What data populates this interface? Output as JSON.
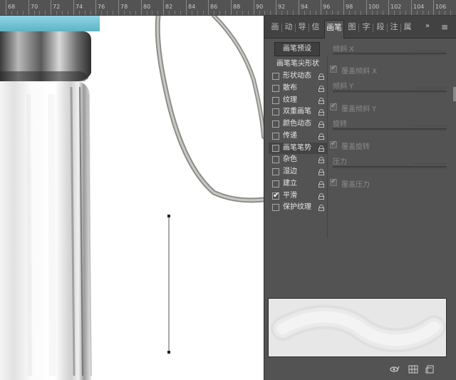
{
  "ruler": {
    "labels": [
      "68",
      "70",
      "72",
      "74",
      "76",
      "78",
      "80",
      "82",
      "84",
      "86",
      "88",
      "90",
      "92",
      "94",
      "96",
      "98",
      "100",
      "102",
      "104",
      "106"
    ]
  },
  "panel": {
    "tabs": [
      {
        "label": "画"
      },
      {
        "label": "动"
      },
      {
        "label": "导"
      },
      {
        "label": "信"
      },
      {
        "label": "画笔"
      },
      {
        "label": "图"
      },
      {
        "label": "字"
      },
      {
        "label": "段"
      },
      {
        "label": "注"
      },
      {
        "label": "属"
      }
    ],
    "active_tab": "画笔",
    "more_glyph": "»",
    "menu_glyph": "≡",
    "preset_button": "画笔预设",
    "list_header": "画笔笔尖形状",
    "items": [
      {
        "label": "形状动态",
        "checked": false,
        "selected": false
      },
      {
        "label": "散布",
        "checked": false,
        "selected": false
      },
      {
        "label": "纹理",
        "checked": false,
        "selected": false
      },
      {
        "label": "双重画笔",
        "checked": false,
        "selected": false
      },
      {
        "label": "颜色动态",
        "checked": false,
        "selected": false
      },
      {
        "label": "传递",
        "checked": false,
        "selected": false
      },
      {
        "label": "画笔笔势",
        "checked": false,
        "selected": true
      },
      {
        "label": "杂色",
        "checked": false,
        "selected": false
      },
      {
        "label": "湿边",
        "checked": false,
        "selected": false
      },
      {
        "label": "建立",
        "checked": false,
        "selected": false
      },
      {
        "label": "平滑",
        "checked": true,
        "selected": false
      },
      {
        "label": "保护纹理",
        "checked": false,
        "selected": false
      }
    ],
    "props": {
      "tilt_x": "倾斜 X",
      "override_tilt_x": "覆盖倾斜 X",
      "tilt_y": "倾斜 Y",
      "override_tilt_y": "覆盖倾斜 Y",
      "rotation": "旋转",
      "override_rotation": "覆盖旋转",
      "pressure": "压力",
      "override_pressure": "覆盖压力"
    },
    "check_glyph": "✔",
    "colors": {
      "panel_bg": "#535353",
      "tab_bar": "#424242",
      "cap_blue": "#7ec8d8"
    }
  }
}
